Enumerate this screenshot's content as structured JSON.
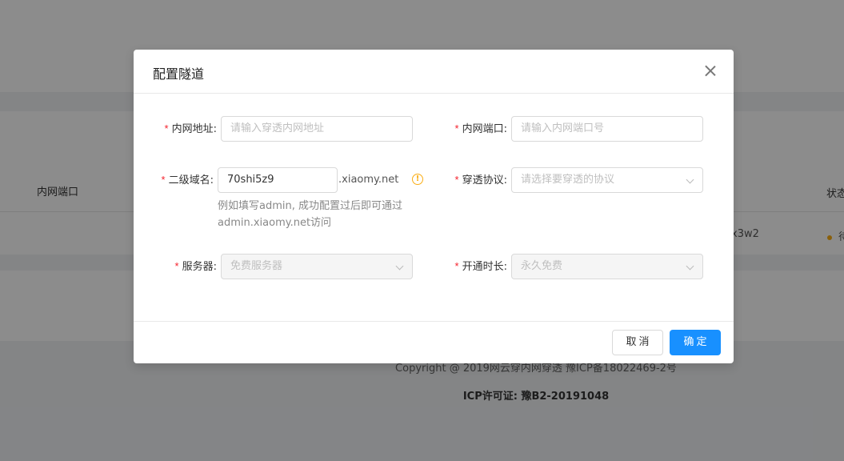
{
  "background": {
    "table_header_port": "内网端口",
    "table_header_status": "状态",
    "row_domain_fragment": "x3w2",
    "row_status_fragment": "待",
    "footer_copyright": "Copyright @ 2019网云穿内网穿透 豫ICP备18022469-2号",
    "footer_icp": "ICP许可证: 豫B2-20191048",
    "status_color": "#faad14"
  },
  "modal": {
    "title": "配置隧道",
    "close_icon": "close-icon",
    "fields": {
      "internal_address": {
        "label": "内网地址:",
        "placeholder": "请输入穿透内网地址"
      },
      "internal_port": {
        "label": "内网端口:",
        "placeholder": "请输入内网端口号"
      },
      "subdomain": {
        "label": "二级域名:",
        "value": "70shi5z9",
        "suffix": ".xiaomy.net",
        "hint": "例如填写admin, 成功配置过后即可通过admin.xiaomy.net访问",
        "info_icon": "info-icon"
      },
      "protocol": {
        "label": "穿透协议:",
        "placeholder": "请选择要穿透的协议"
      },
      "server": {
        "label": "服务器:",
        "value": "免费服务器"
      },
      "duration": {
        "label": "开通时长:",
        "value": "永久免费"
      }
    },
    "required_mark": "*",
    "cancel_label": "取消",
    "ok_label": "确定"
  },
  "colors": {
    "primary": "#1890ff",
    "required": "#f5222d",
    "warning": "#faad14"
  }
}
